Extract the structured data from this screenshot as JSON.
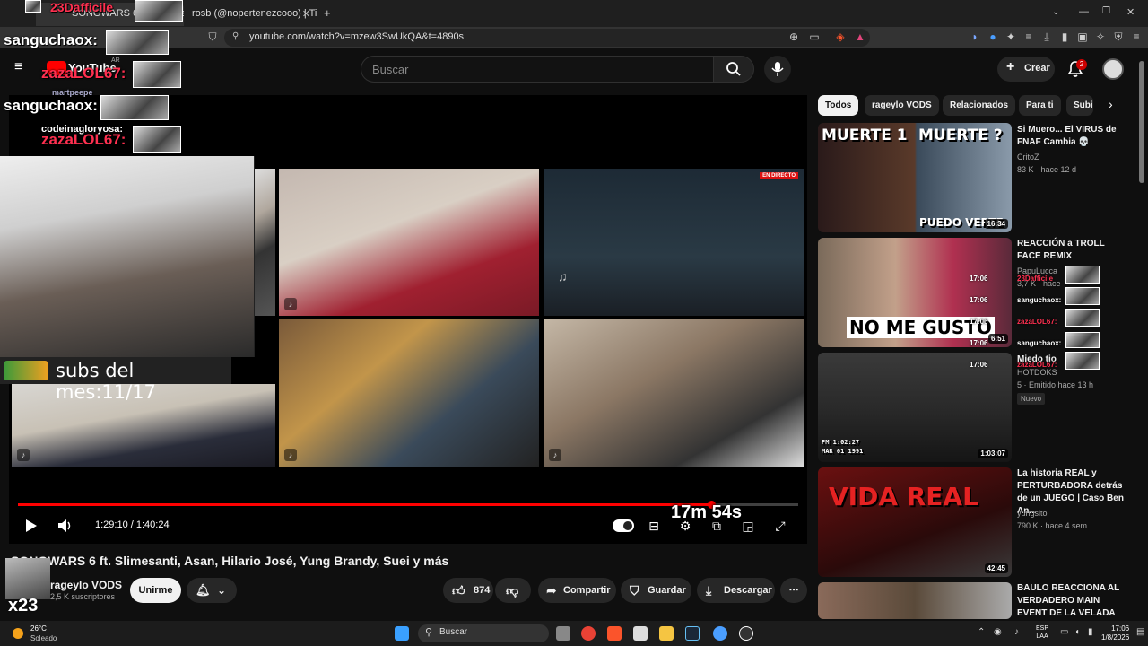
{
  "browser": {
    "tabs": [
      {
        "label": "SONGWARS 6 ft. Slimesanti...",
        "active": true
      },
      {
        "label": "rosb (@nopertenezcooo) | TikTok",
        "active": false
      }
    ],
    "new_tab": "+",
    "url": "youtube.com/watch?v=mzew3SwUkQA&t=4890s"
  },
  "youtube": {
    "logo": "YouTube",
    "region": "AR",
    "search_placeholder": "Buscar",
    "create_label": "Crear",
    "notifications": "2"
  },
  "player": {
    "time": "1:29:10 / 1:40:24",
    "remaining_overlay": "17m 54s",
    "progress_fraction": 0.888,
    "live_badge": "EN DIRECTO",
    "subs_counter": "subs del mes:11/17"
  },
  "video": {
    "title": "SONGWARS 6 ft. Slimesanti, Asan, Hilario José, Yung Brandy, Suei y más",
    "channel": "rageylo VODS",
    "subscribers": "2,5 K suscriptores",
    "join_label": "Unirme",
    "likes": "874",
    "share_label": "Compartir",
    "save_label": "Guardar",
    "download_label": "Descargar",
    "overlay_badge": "x23"
  },
  "sidebar": {
    "chips": [
      "Todos",
      "rageylo VODS",
      "Relacionados",
      "Para ti",
      "Subi"
    ],
    "videos": [
      {
        "title": "Si Muero... El VIRUS de FNAF Cambia 💀",
        "channel": "CritoZ",
        "meta": "83 K · hace 12 d",
        "duration": "16:34",
        "thumb_text_1": "MUERTE 1",
        "thumb_text_2": "MUERTE ?",
        "thumb_text_3": "PUEDO VERTE"
      },
      {
        "title": "REACCIÓN a TROLL FACE REMIX",
        "channel": "PapuLucca",
        "meta": "3,7 K · hace",
        "duration": "6:51",
        "thumb_text_1": "NO ME GUSTO"
      },
      {
        "title": "Miedo tio",
        "channel": "HOTDOKS",
        "meta": "5 · Emitido hace 13 h",
        "duration": "1:03:07",
        "badge": "Nuevo",
        "thumb_text_1": "PM 1:02:27",
        "thumb_text_2": "MAR 01 1991"
      },
      {
        "title": "La historia REAL y PERTURBADORA detrás de un JUEGO | Caso Ben An...",
        "channel": "yungsito",
        "meta": "790 K · hace 4 sem.",
        "duration": "42:45",
        "thumb_text_1": "VIDA REAL"
      },
      {
        "title": "BAULO REACCIONA AL VERDADERO MAIN EVENT DE LA VELADA DEL AÑO",
        "channel": "",
        "meta": "",
        "duration": ""
      }
    ]
  },
  "chat_overlay": [
    {
      "name": "23Dafficile",
      "color": "red"
    },
    {
      "name": "sanguchaox:",
      "color": "white"
    },
    {
      "name": "zazaLOL67:",
      "color": "red"
    },
    {
      "name": "martpeepe",
      "color": "white"
    },
    {
      "name": "sanguchaox:",
      "color": "white"
    },
    {
      "name": "codeinagloryosa:",
      "color": "white"
    },
    {
      "name": "zazaLOL67:",
      "color": "red"
    }
  ],
  "chat_overlay_small": [
    {
      "time": "17:06",
      "name": "23Dafficile",
      "color": "red"
    },
    {
      "time": "17:06",
      "name": "sanguchaox:",
      "color": "white"
    },
    {
      "time": "17:06",
      "name": "zazaLOL67:",
      "color": "red"
    },
    {
      "time": "17:06",
      "name": "sanguchaox:",
      "color": "white"
    },
    {
      "time": "17:06",
      "name": "zazaLOL67:",
      "color": "red"
    }
  ],
  "taskbar": {
    "temp": "26°C",
    "weather": "Soleado",
    "search": "Buscar",
    "lang_1": "ESP",
    "lang_2": "LAA",
    "time": "17:06",
    "date": "1/8/2026"
  },
  "colors": {
    "accent_red": "#ff0000",
    "chat_red": "#ff3050",
    "background": "#0f0f0f"
  }
}
